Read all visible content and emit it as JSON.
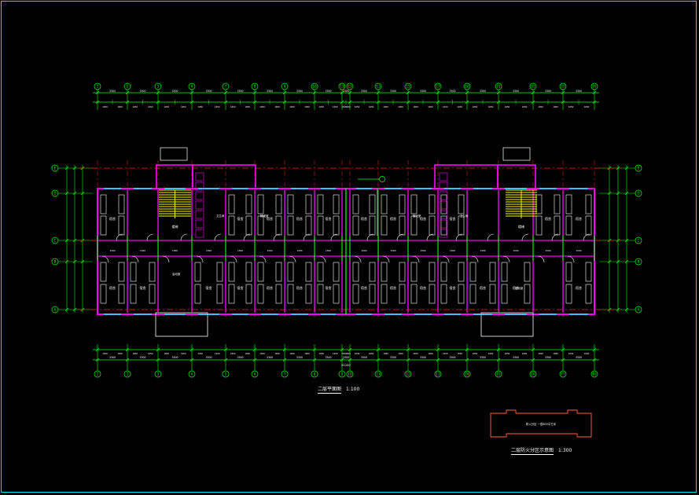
{
  "drawing": {
    "title": "二层平面图",
    "title_scale": "1:100",
    "key_plan_title": "二层防火分区示意图",
    "key_plan_scale": "1:300",
    "key_plan_label": "防火分区 一层800平方米"
  },
  "colors": {
    "background": "#000000",
    "frame": "#00e5e5",
    "grid_axis": "#ff2020",
    "walls": "#ff00ff",
    "dimension": "#00ff00",
    "furniture": "#ffffff",
    "stair": "#ffff00",
    "annotation": "#00ffff"
  },
  "axes_top": [
    "1",
    "2",
    "3",
    "4",
    "7",
    "8",
    "9",
    "10",
    "11",
    "12",
    "13",
    "15",
    "17",
    "18",
    "21",
    "22",
    "23",
    "25"
  ],
  "axes_bottom": [
    "1",
    "2",
    "3",
    "4",
    "5",
    "6",
    "7",
    "8",
    "9",
    "10",
    "11",
    "12",
    "13",
    "14",
    "15",
    "16",
    "17",
    "18"
  ],
  "axes_side": [
    "E",
    "D",
    "C",
    "B",
    "A"
  ],
  "room_labels": {
    "dorm": "宿舍",
    "stair": "楼梯",
    "toilet": "卫生间",
    "storage": "储藏室",
    "duty": "值班室",
    "activity": "活动室"
  }
}
